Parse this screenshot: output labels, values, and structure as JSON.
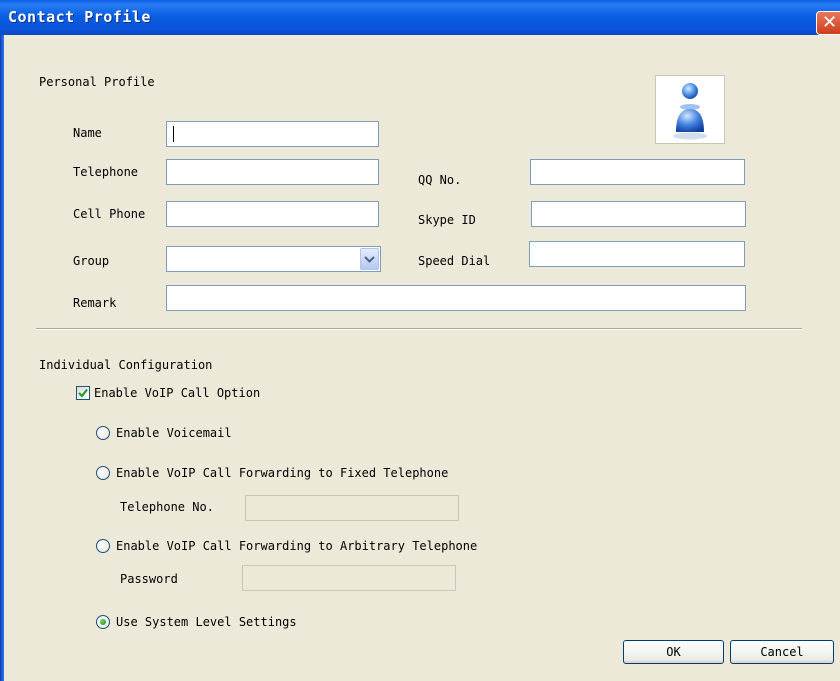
{
  "window": {
    "title": "Contact Profile",
    "close_glyph": "✕"
  },
  "personal": {
    "heading": "Personal Profile",
    "name_label": "Name",
    "telephone_label": "Telephone",
    "cellphone_label": "Cell Phone",
    "group_label": "Group",
    "remark_label": "Remark",
    "qq_label": "QQ No.",
    "skype_label": "Skype ID",
    "speeddial_label": "Speed Dial",
    "name_value": "",
    "telephone_value": "",
    "cellphone_value": "",
    "group_value": "",
    "remark_value": "",
    "qq_value": "",
    "skype_value": "",
    "speeddial_value": "",
    "avatar_icon": "contact-avatar-icon"
  },
  "individual": {
    "heading": "Individual Configuration",
    "enable_voip_label": "Enable VoIP Call Option",
    "enable_voip_checked": true,
    "options": [
      {
        "label": "Enable Voicemail",
        "selected": false
      },
      {
        "label": "Enable VoIP Call Forwarding to Fixed Telephone",
        "selected": false
      },
      {
        "label": "Enable VoIP Call Forwarding to Arbitrary Telephone",
        "selected": false
      },
      {
        "label": "Use System Level Settings",
        "selected": true
      }
    ],
    "telephone_no_label": "Telephone No.",
    "telephone_no_value": "",
    "password_label": "Password",
    "password_value": ""
  },
  "buttons": {
    "ok": "OK",
    "cancel": "Cancel"
  },
  "colors": {
    "title_bar": "#0a5de6",
    "dialog_bg": "#ece9d8",
    "input_border": "#7f9db9",
    "accent_green": "#1c8a18"
  }
}
